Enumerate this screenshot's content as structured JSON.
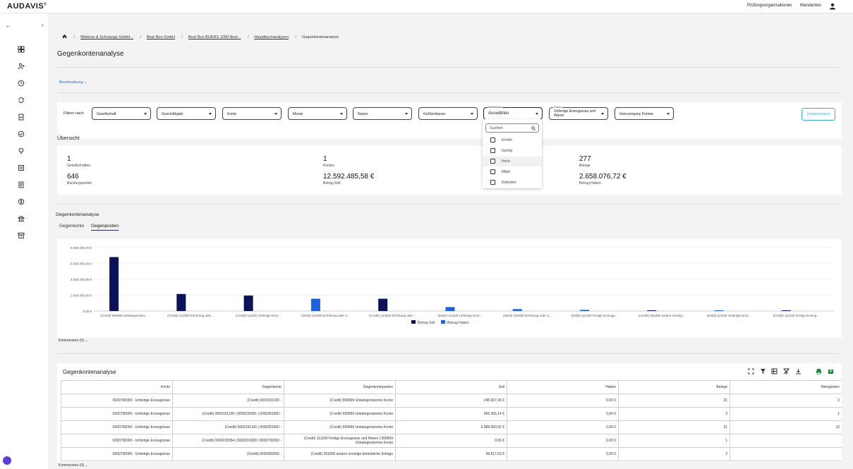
{
  "header": {
    "logo": "AUDAVIS",
    "logo_mark": "®",
    "links": [
      "Prüfungsorganisationen",
      "Mandanten"
    ]
  },
  "breadcrumb": [
    "Webinar & Schulungs GmbH...",
    "Best Run GmbH",
    "Best Run BUKRS 1000 Next...",
    "Hauptbuchanalysen",
    "Gegenkontenanalyse"
  ],
  "page_title": "Gegenkontenanalyse",
  "description_link": "Beschreibung",
  "filters": {
    "label": "Filtern nach",
    "selects": [
      "Gesellschaft",
      "Geschäftsjahr",
      "Konto",
      "Monat",
      "Nutzer",
      "Größenklasse"
    ],
    "risk": {
      "label": "Risikoklasse",
      "value": "Auswählen"
    },
    "poster": {
      "label": "Posten",
      "value": "Unfertige Erzeugnisse und Waren"
    },
    "partner": "Intercompany Partner",
    "reset": "Zurücksetzen"
  },
  "dropdown": {
    "search_placeholder": "Suchen",
    "options": [
      "Erhöht",
      "Gering",
      "Hoch",
      "Mittel",
      "Risikofrei"
    ]
  },
  "overview": {
    "title": "Übersicht",
    "kpis": [
      {
        "value": "1",
        "label": "Gesellschaften"
      },
      {
        "value": "646",
        "label": "Buchungszeilen"
      },
      {
        "value": "1",
        "label": "Konten"
      },
      {
        "value": "12.592.485,58 €",
        "label": "Betrag Soll"
      },
      {
        "value": "277",
        "label": "Belege"
      },
      {
        "value": "2.658.076,72 €",
        "label": "Betrag Haben"
      }
    ]
  },
  "analysis": {
    "title": "Gegenkontenanalyse",
    "tabs": [
      "Gegenkonto",
      "Gegenposten"
    ],
    "active_tab": 1,
    "comments": "Kommentare (0)"
  },
  "chart_data": {
    "type": "bar",
    "title": "",
    "categories": [
      "(Credit) 999999 Unkategorisiert...",
      "(Credit) 312000 Erhöhung oder ...",
      "(Credit) 111100 Unfertige Erze...",
      "(Debit) 312000 Erhöhung oder V...",
      "(Credit) 312000 Erhöhung oder ...",
      "(Debit) 111100 Unfertige Erze...",
      "(Debit) 312000 Erhöhung oder V...",
      "(Debit) 111200 Fertige Erzeugn...",
      "(Credit) 351800 andere sonstig...",
      "(Debit) 111100 Unfertige Erze...",
      "(Credit) 111200 Fertige Erzeug..."
    ],
    "series": [
      {
        "name": "Betrag Soll",
        "color": "#0b1257",
        "values": [
          6800000,
          2150000,
          1950000,
          0,
          1550000,
          0,
          0,
          0,
          60000,
          0,
          20000
        ]
      },
      {
        "name": "Betrag Haben",
        "color": "#1f62e0",
        "values": [
          0,
          0,
          0,
          1550000,
          0,
          500000,
          240000,
          150000,
          0,
          40000,
          0
        ]
      }
    ],
    "ylim": [
      0,
      8000000
    ],
    "yticks": [
      "0,00 €",
      "2.000.000,00 €",
      "4.000.000,00 €",
      "6.000.000,00 €",
      "8.000.000,00 €"
    ],
    "legend": "bottom-center",
    "grid": true
  },
  "table": {
    "title": "Gegenkontenanalyse",
    "columns": [
      "Konto",
      "Gegenkonto",
      "Gegenkontoposten",
      "Soll",
      "Haben",
      "Belege",
      "Belegzeilen"
    ],
    "rows": [
      [
        "0000790000 - Unfertige Erzeugnisse",
        "(Credit) 0000191100 -",
        "(Credit) 999999 Unkategorisiertes Konto",
        "245.667,36 €",
        "0,00 €",
        "21",
        "2"
      ],
      [
        "0000790000 - Unfertige Erzeugnisse",
        "(Credit) 0000191100 | 0000230051 | 0000281500 -",
        "(Credit) 999999 Unkategorisiertes Konto",
        "566.305,14 €",
        "0,00 €",
        "3",
        "1"
      ],
      [
        "0000790000 - Unfertige Erzeugnisse",
        "(Credit) 0000191100 | 0000281500 -",
        "(Credit) 999999 Unkategorisiertes Konto",
        "5.988.960,02 €",
        "0,00 €",
        "31",
        "12"
      ],
      [
        "0000790000 - Unfertige Erzeugnisse",
        "(Credit) 0000230054 | 0000310000 | 0000792000 -",
        "(Credit) 111200 Fertige Erzeugnisse und Waren | 999999 Unkategorisiertes Konto",
        "0,06 €",
        "0,00 €",
        "1",
        ""
      ],
      [
        "0000790000 - Unfertige Erzeugnisse",
        "(Credit) 0000282500 -",
        "(Credit) 351800 andere sonstige betriebliche Erträge",
        "99.817,63 €",
        "0,00 €",
        "2",
        ""
      ]
    ],
    "comments": "Kommentare (0)"
  }
}
